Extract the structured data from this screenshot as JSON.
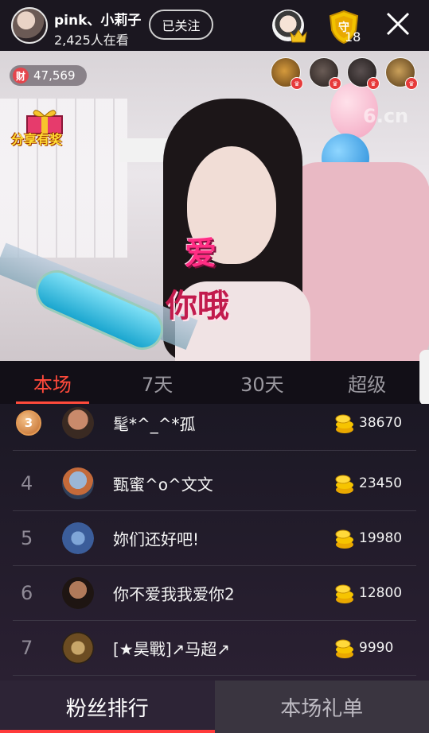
{
  "header": {
    "host_name": "pink、小莉子",
    "viewers": "2,425人在看",
    "follow_label": "已关注",
    "guard_count": "18"
  },
  "video": {
    "wealth_icon_label": "财",
    "wealth_value": "47,569",
    "share_label": "分享有奖",
    "watermark": "6.cn",
    "overlay_line1": "爱",
    "overlay_line2": "你哦"
  },
  "tabs": [
    {
      "label": "本场",
      "active": true
    },
    {
      "label": "7天",
      "active": false
    },
    {
      "label": "30天",
      "active": false
    },
    {
      "label": "超级",
      "active": false
    }
  ],
  "ranking": [
    {
      "rank": "3",
      "name": "髦*^_^*孤",
      "score": "38670",
      "medal": true
    },
    {
      "rank": "4",
      "name": "甄蜜^o^文文",
      "score": "23450",
      "medal": false
    },
    {
      "rank": "5",
      "name": "妳们还好吧!",
      "score": "19980",
      "medal": false
    },
    {
      "rank": "6",
      "name": "你不爱我我爱你2",
      "score": "12800",
      "medal": false
    },
    {
      "rank": "7",
      "name": "[★昊戰]↗马超↗",
      "score": "9990",
      "medal": false
    }
  ],
  "bottom_tabs": [
    {
      "label": "粉丝排行",
      "active": true
    },
    {
      "label": "本场礼单",
      "active": false
    }
  ],
  "icons": {
    "close": "close-icon",
    "crown": "crown-icon",
    "guard": "shield-icon",
    "coin": "coin-stack-icon"
  },
  "colors": {
    "accent": "#ff4a3b",
    "gold": "#f2c200"
  }
}
